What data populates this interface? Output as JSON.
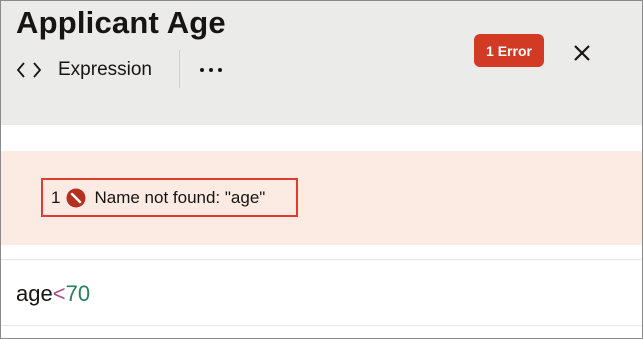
{
  "header": {
    "title": "Applicant Age",
    "mode_label": "Expression",
    "more_icon": "more-horizontal-icon",
    "code_icon": "code-brackets-icon",
    "close_icon": "close-icon",
    "error_badge": "1 Error"
  },
  "messages": [
    {
      "index": "1",
      "icon": "error-circle-icon",
      "text": "Name not found: \"age\""
    }
  ],
  "editor": {
    "tokens": {
      "identifier": "age",
      "operator": "<",
      "number": "70"
    }
  },
  "colors": {
    "header_bg": "#ebebea",
    "error_badge_bg": "#d33a25",
    "message_band_bg": "#fcebe3",
    "highlight_border": "#e03c31",
    "error_icon": "#b5311f",
    "operator_color": "#a64e80",
    "number_color": "#2e7d5b"
  }
}
